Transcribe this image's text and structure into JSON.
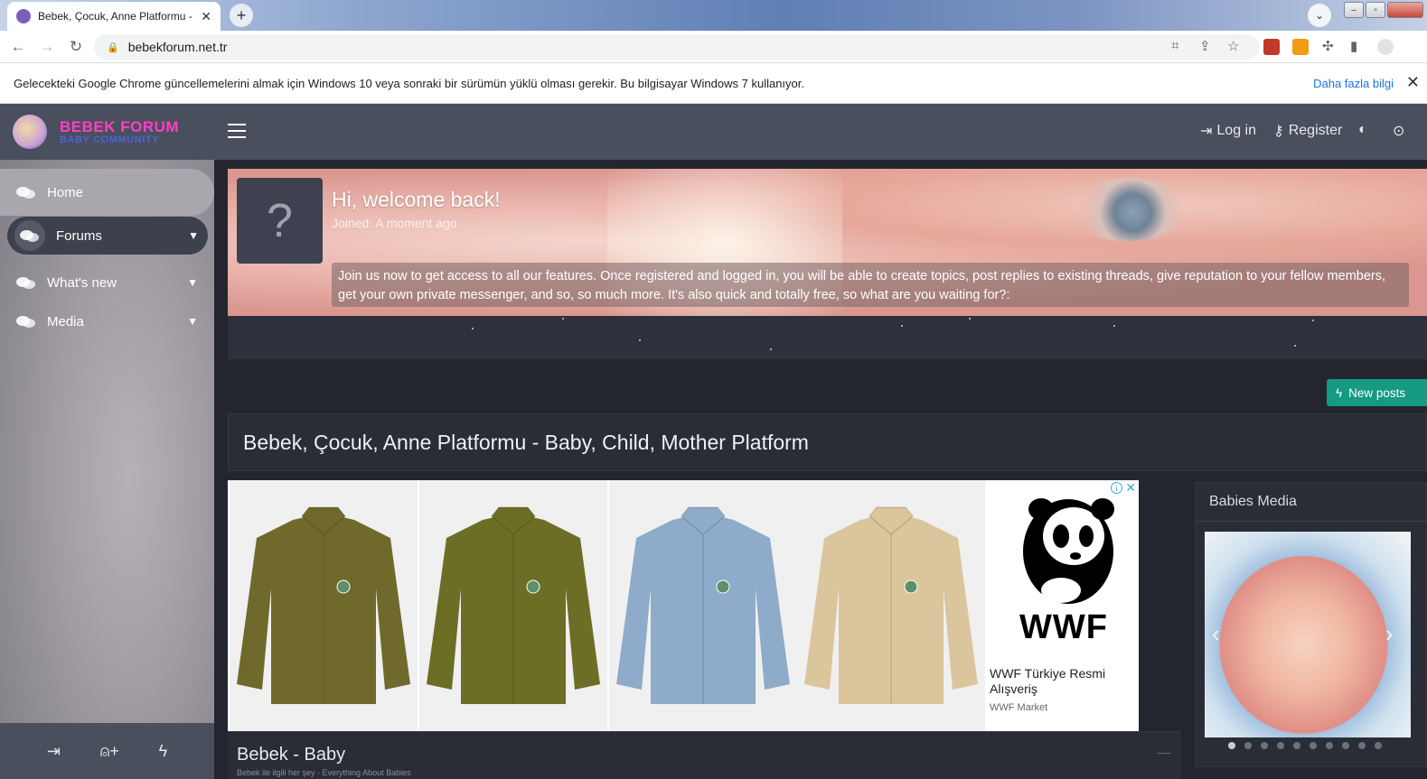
{
  "browser": {
    "tab_title": "Bebek, Çocuk, Anne Platformu - B",
    "url": "bebekforum.net.tr",
    "infobar_text": "Gelecekteki Google Chrome güncellemelerini almak için Windows 10 veya sonraki bir sürümün yüklü olması gerekir. Bu bilgisayar Windows 7 kullanıyor.",
    "infobar_link": "Daha fazla bilgi"
  },
  "site": {
    "logo_main": "BEBEK FORUM",
    "logo_sub": "BABY COMMUNITY",
    "colors": {
      "accent": "#159a83",
      "logo_pink": "#ff3fc5",
      "logo_blue": "#4e62d6",
      "header_bg": "#4a4f5d"
    }
  },
  "sidebar": {
    "items": [
      {
        "label": "Home",
        "icon": "chat-bubbles-icon"
      },
      {
        "label": "Forums",
        "icon": "chat-bubbles-icon",
        "expandable": true
      },
      {
        "label": "What's new",
        "icon": "chat-bubbles-icon",
        "expandable": true
      },
      {
        "label": "Media",
        "icon": "chat-bubbles-icon",
        "expandable": true
      }
    ],
    "footer_icons": [
      "login-icon",
      "add-user-icon",
      "bolt-icon"
    ]
  },
  "topbar": {
    "login_label": "Log in",
    "register_label": "Register"
  },
  "welcome": {
    "avatar_glyph": "?",
    "heading": "Hi, welcome back!",
    "joined_text": "Joined: A moment ago",
    "promo": "Join us now to get access to all our features. Once registered and logged in, you will be able to create topics, post replies to existing threads, give reputation to your fellow members, get your own private messenger, and so, so much more. It's also quick and totally free, so what are you waiting for?:"
  },
  "new_posts_label": "New posts",
  "page_title": "Bebek, Çocuk, Anne Platformu - Baby, Child, Mother Platform",
  "ad": {
    "advertiser_title": "WWF Türkiye Resmi Alışveriş",
    "advertiser_sub": "WWF Market",
    "logo_word": "WWF",
    "jacket_colors": [
      "#6f6a2c",
      "#6d6e26",
      "#8eacc9",
      "#dbc59d"
    ]
  },
  "media_panel": {
    "title": "Babies Media",
    "slide_count": 10,
    "active_slide": 1
  },
  "category": {
    "title": "Bebek - Baby",
    "description": "Bebek ile ilgili her şey - Everything About Babies"
  }
}
